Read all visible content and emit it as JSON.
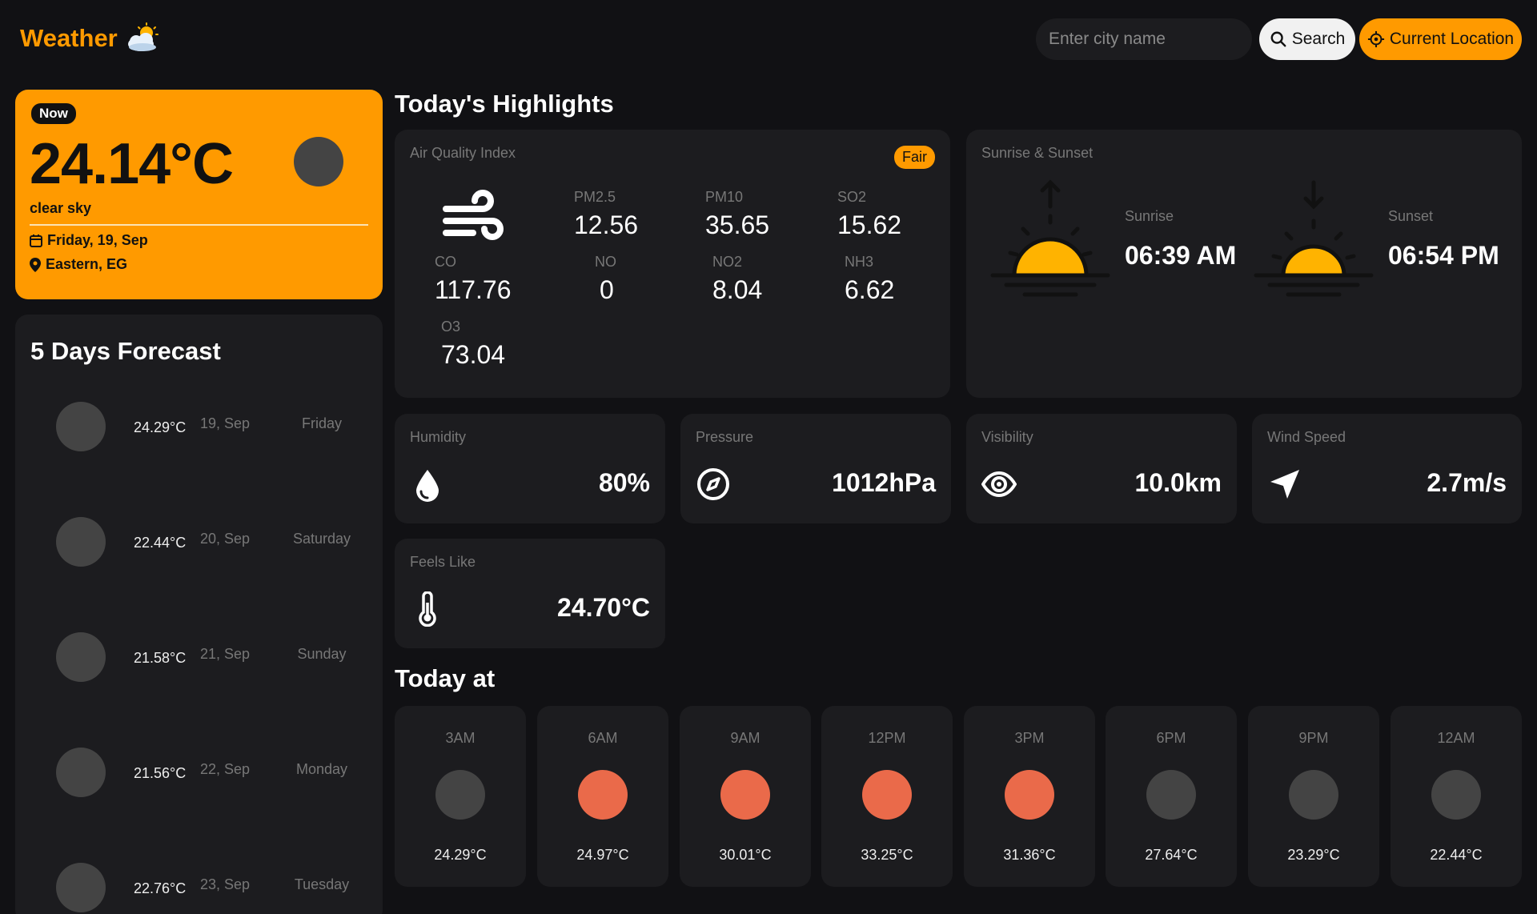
{
  "header": {
    "logo_text": "Weather",
    "search_placeholder": "Enter city name",
    "search_label": "Search",
    "location_label": "Current Location"
  },
  "current": {
    "badge": "Now",
    "temp": "24.14°C",
    "desc": "clear sky",
    "date": "Friday, 19, Sep",
    "location": "Eastern, EG"
  },
  "forecast": {
    "title": "5 Days Forecast",
    "days": [
      {
        "temp": "24.29°C",
        "date": "19, Sep",
        "day": "Friday"
      },
      {
        "temp": "22.44°C",
        "date": "20, Sep",
        "day": "Saturday"
      },
      {
        "temp": "21.58°C",
        "date": "21, Sep",
        "day": "Sunday"
      },
      {
        "temp": "21.56°C",
        "date": "22, Sep",
        "day": "Monday"
      },
      {
        "temp": "22.76°C",
        "date": "23, Sep",
        "day": "Tuesday"
      }
    ]
  },
  "highlights": {
    "title": "Today's Highlights",
    "aqi": {
      "label": "Air Quality Index",
      "badge": "Fair",
      "pm25_label": "PM2.5",
      "pm25": "12.56",
      "pm10_label": "PM10",
      "pm10": "35.65",
      "so2_label": "SO2",
      "so2": "15.62",
      "co_label": "CO",
      "co": "117.76",
      "no_label": "NO",
      "no": "0",
      "no2_label": "NO2",
      "no2": "8.04",
      "nh3_label": "NH3",
      "nh3": "6.62",
      "o3_label": "O3",
      "o3": "73.04"
    },
    "sun": {
      "label": "Sunrise & Sunset",
      "sunrise_label": "Sunrise",
      "sunrise": "06:39 AM",
      "sunset_label": "Sunset",
      "sunset": "06:54 PM"
    },
    "humidity": {
      "label": "Humidity",
      "value": "80%"
    },
    "pressure": {
      "label": "Pressure",
      "value": "1012hPa"
    },
    "visibility": {
      "label": "Visibility",
      "value": "10.0km"
    },
    "wind": {
      "label": "Wind Speed",
      "value": "2.7m/s"
    },
    "feels": {
      "label": "Feels Like",
      "value": "24.70°C"
    }
  },
  "today": {
    "title": "Today at",
    "hours": [
      {
        "time": "3AM",
        "temp": "24.29°C",
        "icon_color": "#444444"
      },
      {
        "time": "6AM",
        "temp": "24.97°C",
        "icon_color": "#ea6a4a"
      },
      {
        "time": "9AM",
        "temp": "30.01°C",
        "icon_color": "#ea6a4a"
      },
      {
        "time": "12PM",
        "temp": "33.25°C",
        "icon_color": "#ea6a4a"
      },
      {
        "time": "3PM",
        "temp": "31.36°C",
        "icon_color": "#ea6a4a"
      },
      {
        "time": "6PM",
        "temp": "27.64°C",
        "icon_color": "#444444"
      },
      {
        "time": "9PM",
        "temp": "23.29°C",
        "icon_color": "#444444"
      },
      {
        "time": "12AM",
        "temp": "22.44°C",
        "icon_color": "#444444"
      }
    ]
  },
  "colors": {
    "accent": "#ff9a00",
    "background": "#111114",
    "card": "#1c1c1f"
  },
  "icons": {
    "logo": "cloud-sun-icon",
    "search": "search-icon",
    "location": "crosshair-icon",
    "calendar": "calendar-icon",
    "pin": "map-pin-icon",
    "aqi": "wind-icon",
    "sunrise": "sunrise-icon",
    "sunset": "sunset-icon",
    "humidity": "droplet-icon",
    "pressure": "compass-icon",
    "visibility": "eye-icon",
    "wind": "navigation-arrow-icon",
    "feels": "thermometer-icon"
  }
}
